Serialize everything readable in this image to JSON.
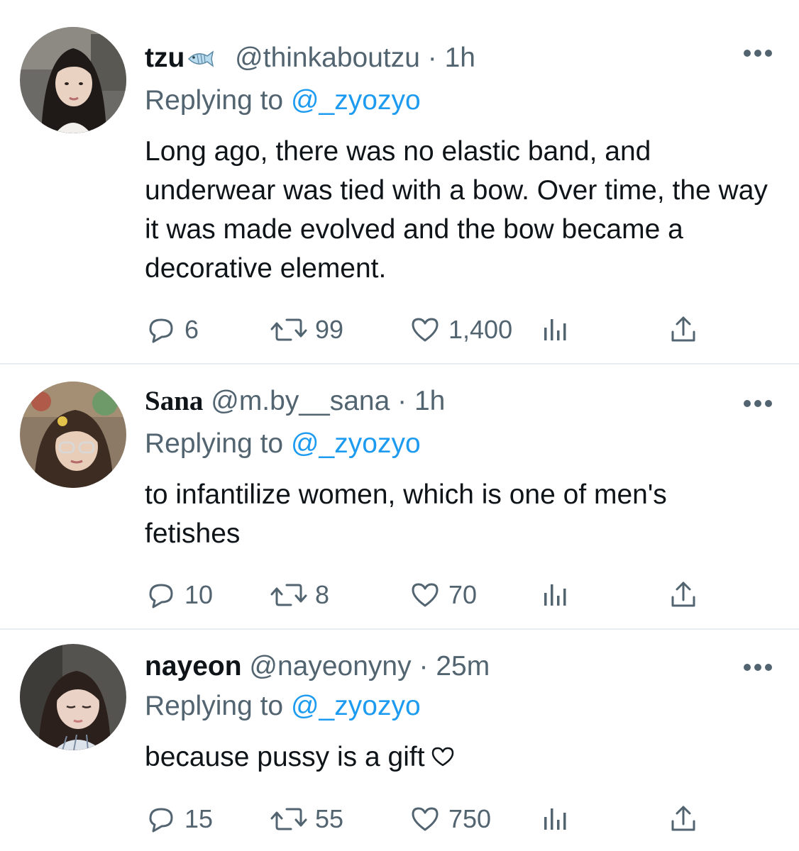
{
  "tweets": [
    {
      "display_name": "tzu",
      "name_emoji": "fish-icon",
      "handle": "@thinkaboutzu",
      "separator": "·",
      "time": "1h",
      "replying_prefix": "Replying to",
      "replying_to": "@_zyozyo",
      "text": "Long ago, there was no elastic band, and underwear was tied with a bow. Over time, the way it was made evolved and the bow became a decorative element.",
      "replies": "6",
      "retweets": "99",
      "likes": "1,400"
    },
    {
      "display_name": "Sana",
      "handle": "@m.by__sana",
      "separator": "·",
      "time": "1h",
      "replying_prefix": "Replying to",
      "replying_to": "@_zyozyo",
      "text": "to infantilize women, which is one of men's fetishes",
      "replies": "10",
      "retweets": "8",
      "likes": "70"
    },
    {
      "display_name": "nayeon",
      "handle": "@nayeonyny",
      "separator": "·",
      "time": "25m",
      "replying_prefix": "Replying to",
      "replying_to": "@_zyozyo",
      "text": "because pussy is a gift",
      "text_trailing_icon": "heart-outline-icon",
      "replies": "15",
      "retweets": "55",
      "likes": "750"
    }
  ],
  "icons": {
    "more": "more-dots-icon",
    "reply": "reply-bubble-icon",
    "retweet": "retweet-icon",
    "like": "heart-icon",
    "analytics": "analytics-bars-icon",
    "share": "share-icon"
  },
  "colors": {
    "text": "#0f1419",
    "secondary": "#536471",
    "mention": "#1d9bf0",
    "divider": "#e6ecf0"
  }
}
